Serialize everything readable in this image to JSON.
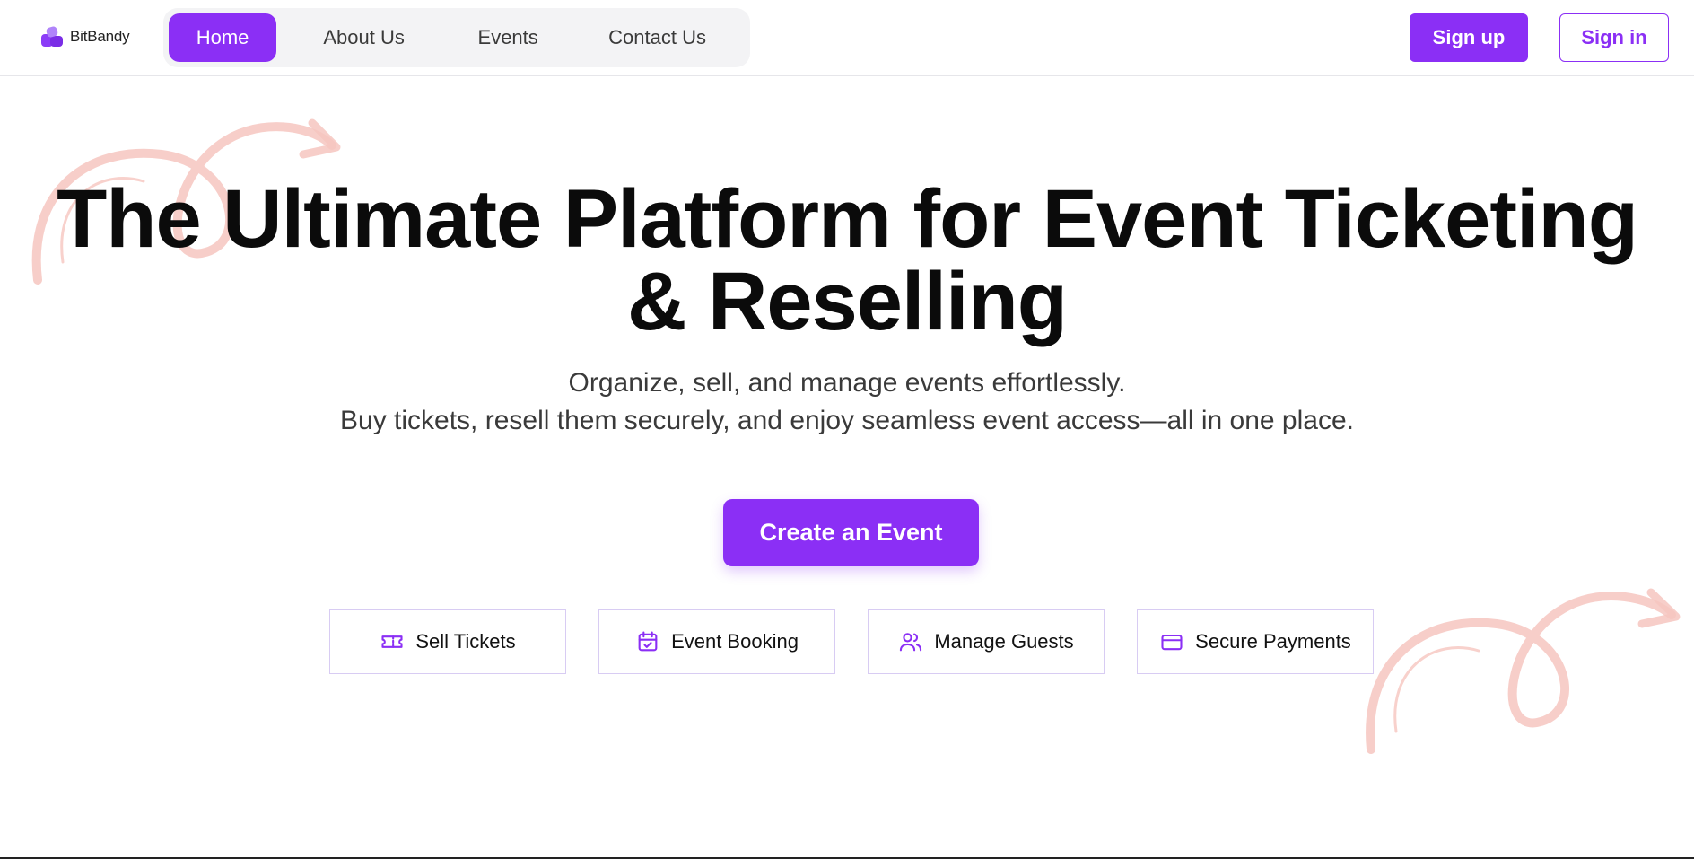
{
  "header": {
    "logo_text": "BitBandy",
    "nav": [
      {
        "label": "Home",
        "active": true
      },
      {
        "label": "About Us",
        "active": false
      },
      {
        "label": "Events",
        "active": false
      },
      {
        "label": "Contact Us",
        "active": false
      }
    ],
    "signup_label": "Sign up",
    "signin_label": "Sign in"
  },
  "hero": {
    "title_line1": "The Ultimate Platform for Event Ticketing",
    "title_line2": "& Reselling",
    "subtitle_line1": "Organize, sell, and manage events effortlessly.",
    "subtitle_line2": "Buy tickets, resell them securely, and enjoy seamless event access—all in one place.",
    "cta_label": "Create an Event"
  },
  "features": [
    {
      "label": "Sell Tickets",
      "icon": "ticket-icon"
    },
    {
      "label": "Event Booking",
      "icon": "calendar-check-icon"
    },
    {
      "label": "Manage Guests",
      "icon": "users-icon"
    },
    {
      "label": "Secure Payments",
      "icon": "credit-card-icon"
    }
  ],
  "colors": {
    "accent": "#8b2ff5",
    "decoration": "#f6c6bf",
    "nav_bg": "#f3f3f5"
  }
}
